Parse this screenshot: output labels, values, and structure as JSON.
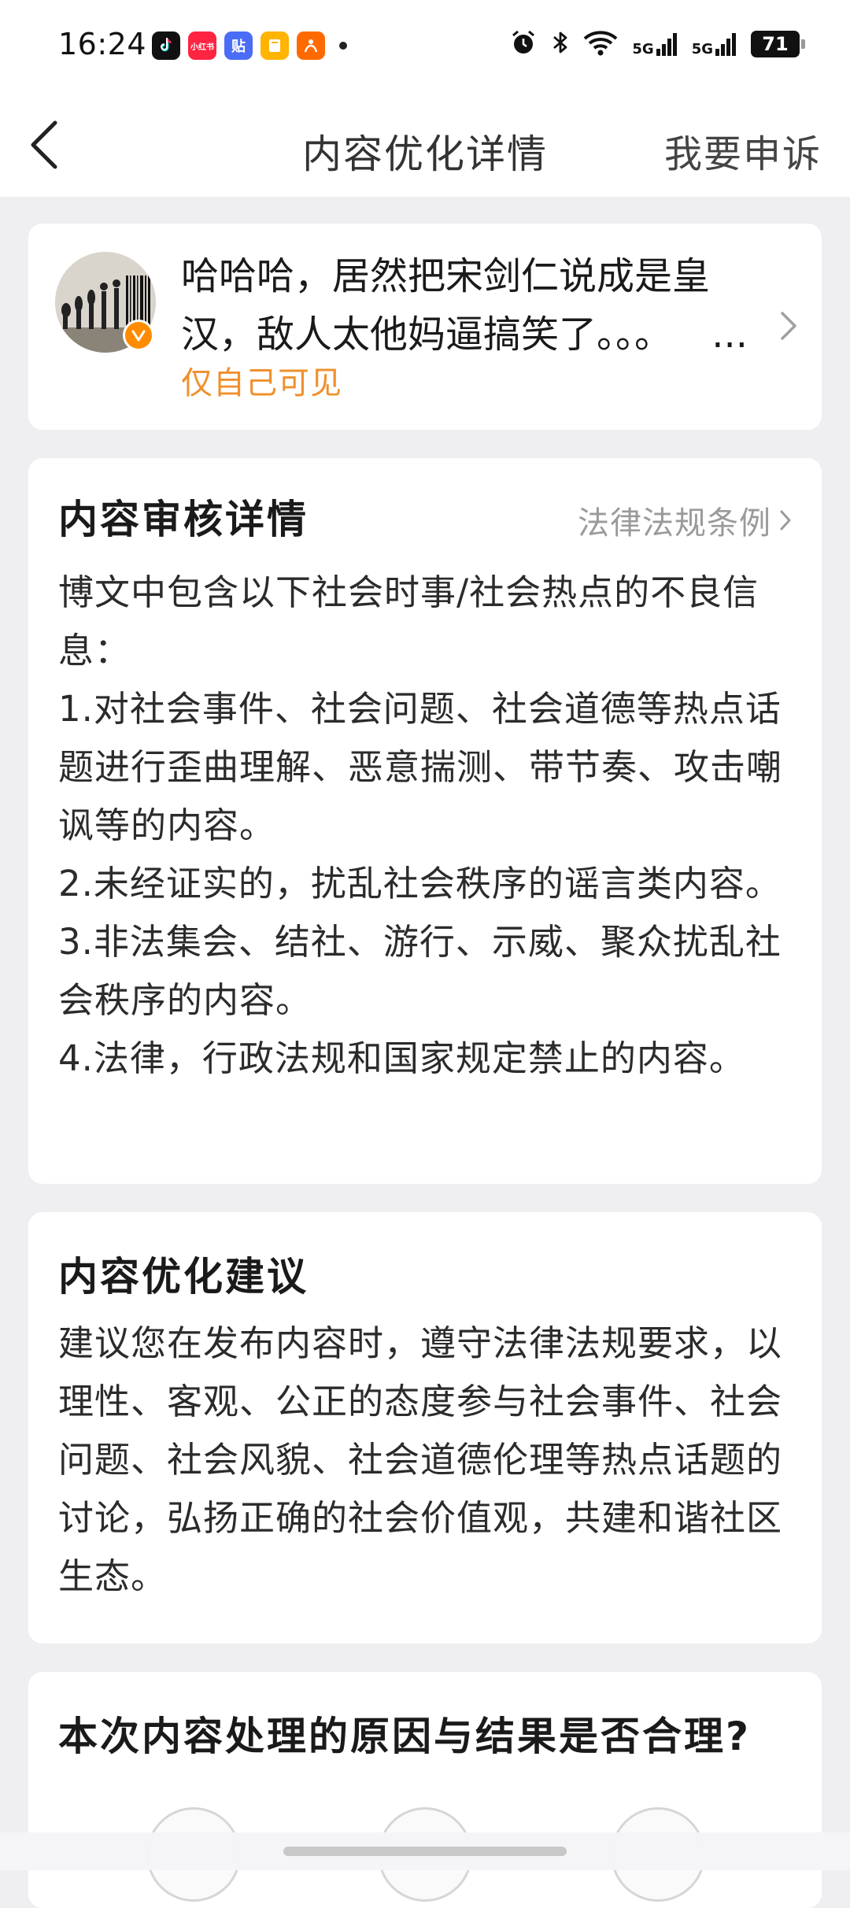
{
  "status_bar": {
    "time": "16:24",
    "battery": "71",
    "network_1": "5G",
    "network_2": "5G",
    "app_icons": [
      "tiktok-icon",
      "xiaohongshu-icon",
      "tieba-icon",
      "reader-icon",
      "taobao-icon"
    ],
    "app_badge_labels": [
      "",
      "小红书",
      "贴",
      "",
      ""
    ]
  },
  "nav": {
    "title": "内容优化详情",
    "appeal_label": "我要申诉"
  },
  "post": {
    "text": "哈哈哈，居然把宋剑仁说成是皇汉，敌人太他妈逼搞笑了。。。",
    "ellipsis": "...",
    "visibility": "仅自己可见"
  },
  "review": {
    "title": "内容审核详情",
    "law_link_label": "法律法规条例",
    "paragraphs": [
      "博文中包含以下社会时事/社会热点的不良信息：",
      "1.对社会事件、社会问题、社会道德等热点话题进行歪曲理解、恶意揣测、带节奏、攻击嘲讽等的内容。",
      "2.未经证实的，扰乱社会秩序的谣言类内容。",
      "3.非法集会、结社、游行、示威、聚众扰乱社会秩序的内容。",
      "4.法律，行政法规和国家规定禁止的内容。"
    ]
  },
  "suggestion": {
    "title": "内容优化建议",
    "text": "建议您在发布内容时，遵守法律法规要求，以理性、客观、公正的态度参与社会事件、社会问题、社会风貌、社会道德伦理等热点话题的讨论，弘扬正确的社会价值观，共建和谐社区生态。"
  },
  "feedback": {
    "question": "本次内容处理的原因与结果是否合理?"
  },
  "colors": {
    "accent_orange": "#f0902d",
    "page_background": "#efeff1",
    "card_background": "#ffffff",
    "muted_text": "#9a9a9a"
  }
}
